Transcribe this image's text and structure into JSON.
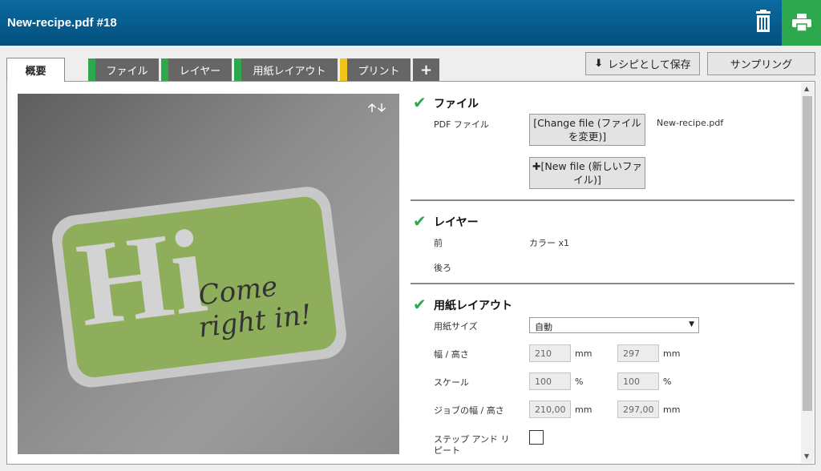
{
  "header": {
    "title": "New-recipe.pdf #18",
    "trash_icon": "trash-icon",
    "print_icon": "printer-icon",
    "accent": "#2ea84e"
  },
  "tabs": [
    {
      "label": "概要",
      "color": ""
    },
    {
      "label": "ファイル",
      "color": "#2ea84e"
    },
    {
      "label": "レイヤー",
      "color": "#2ea84e"
    },
    {
      "label": "用紙レイアウト",
      "color": "#2ea84e"
    },
    {
      "label": "プリント",
      "color": "#f0c419"
    },
    {
      "label": "+"
    }
  ],
  "actions": {
    "save_recipe": "レシピとして保存",
    "sampling": "サンプリング"
  },
  "preview": {
    "big_text": "Hi",
    "script_line1": "Come",
    "script_line2": "right in!"
  },
  "sections": {
    "file": {
      "title": "ファイル",
      "pdf_label": "PDF ファイル",
      "change_btn": "[Change file (ファイルを変更)]",
      "new_btn": "[New file (新しいファイル)]",
      "filename": "New-recipe.pdf"
    },
    "layer": {
      "title": "レイヤー",
      "front_label": "前",
      "front_value": "カラー x1",
      "back_label": "後ろ"
    },
    "paper": {
      "title": "用紙レイアウト",
      "size_label": "用紙サイズ",
      "size_value": "自動",
      "wh_label": "幅 / 高さ",
      "width": "210",
      "height": "297",
      "scale_label": "スケール",
      "scale_x": "100",
      "scale_y": "100",
      "job_label": "ジョブの幅 / 高さ",
      "job_w": "210,00",
      "job_h": "297,00",
      "mm": "mm",
      "pct": "%",
      "step_label_1": "ステップ アンド リ",
      "step_label_2": "ピート"
    }
  }
}
